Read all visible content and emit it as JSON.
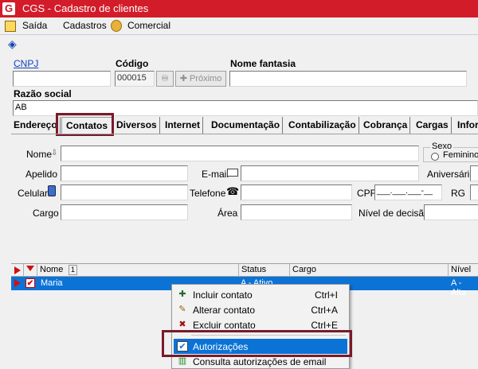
{
  "window": {
    "title": "CGS - Cadastro de clientes",
    "icon": "G"
  },
  "menubar": {
    "items": [
      "Saída",
      "Cadastros",
      "Comercial"
    ]
  },
  "header": {
    "cnpj_label": "CNPJ",
    "codigo_label": "Código",
    "codigo_value": "000015",
    "proximo_label": "Próximo",
    "nome_fantasia_label": "Nome fantasia",
    "razao_social_label": "Razão social",
    "razao_social_value": "AB"
  },
  "tabs": [
    "Endereço",
    "Contatos",
    "Diversos",
    "Internet",
    "Documentação",
    "Contabilização",
    "Cobrança",
    "Cargas",
    "Infor"
  ],
  "form": {
    "nome_label": "Nome",
    "sexo_label": "Sexo",
    "feminino_label": "Feminino",
    "apelido_label": "Apelido",
    "email_label": "E-mail",
    "aniversario_label": "Aniversário",
    "celular_label": "Celular",
    "telefone_label": "Telefone",
    "cpf_label": "CPF",
    "cpf_mask": "___.___.___-__",
    "rg_label": "RG",
    "cargo_label": "Cargo",
    "area_label": "Área",
    "nivel_label": "Nível de decisão"
  },
  "grid": {
    "columns": [
      "Nome",
      "Status",
      "Cargo",
      "Nível"
    ],
    "sort_indicator": "1",
    "rows": [
      {
        "nome": "Maria",
        "status": "A - Ativo",
        "cargo": "",
        "nivel": "A - Alta"
      }
    ]
  },
  "context_menu": {
    "items": [
      {
        "label": "Incluir contato",
        "shortcut": "Ctrl+I",
        "icon": "add-contact-icon"
      },
      {
        "label": "Alterar contato",
        "shortcut": "Ctrl+A",
        "icon": "edit-contact-icon"
      },
      {
        "label": "Excluir contato",
        "shortcut": "Ctrl+E",
        "icon": "delete-contact-icon"
      },
      {
        "label": "Autorizações",
        "shortcut": "",
        "icon": "authorizations-icon"
      },
      {
        "label": "Consulta autorizações de email",
        "shortcut": "",
        "icon": "chart-icon"
      }
    ]
  },
  "colors": {
    "titlebar": "#d31c2a",
    "selection": "#0b73d6",
    "highlight_box": "#7a1a2a"
  }
}
